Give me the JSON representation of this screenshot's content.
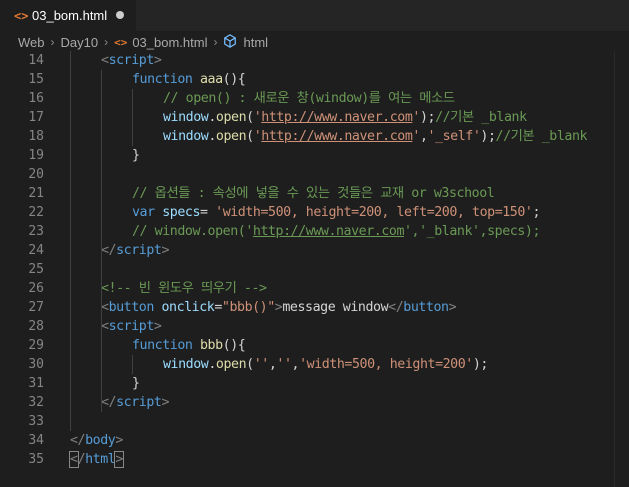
{
  "tab": {
    "filename": "03_bom.html",
    "icon": "html-file-icon"
  },
  "breadcrumb": {
    "parts": [
      "Web",
      "Day10",
      "03_bom.html",
      "html"
    ]
  },
  "lines": [
    {
      "n": 14,
      "indent": 1,
      "tokens": [
        [
          "bracket",
          "<"
        ],
        [
          "tag",
          "script"
        ],
        [
          "bracket",
          ">"
        ]
      ]
    },
    {
      "n": 15,
      "indent": 2,
      "tokens": [
        [
          "kw",
          "function "
        ],
        [
          "fn",
          "aaa"
        ],
        [
          "txt",
          "(){"
        ]
      ]
    },
    {
      "n": 16,
      "indent": 3,
      "tokens": [
        [
          "com",
          "// open() : 새로운 창(window)를 여는 메소드"
        ]
      ]
    },
    {
      "n": 17,
      "indent": 3,
      "tokens": [
        [
          "var",
          "window"
        ],
        [
          "txt",
          "."
        ],
        [
          "fn",
          "open"
        ],
        [
          "txt",
          "("
        ],
        [
          "str",
          "'"
        ],
        [
          "url",
          "http://www.naver.com"
        ],
        [
          "str",
          "'"
        ],
        [
          "txt",
          ");"
        ],
        [
          "com",
          "//기본 _blank"
        ]
      ]
    },
    {
      "n": 18,
      "indent": 3,
      "tokens": [
        [
          "var",
          "window"
        ],
        [
          "txt",
          "."
        ],
        [
          "fn",
          "open"
        ],
        [
          "txt",
          "("
        ],
        [
          "str",
          "'"
        ],
        [
          "url",
          "http://www.naver.com"
        ],
        [
          "str",
          "'"
        ],
        [
          "txt",
          ","
        ],
        [
          "str",
          "'_self'"
        ],
        [
          "txt",
          ");"
        ],
        [
          "com",
          "//기본 _blank"
        ]
      ]
    },
    {
      "n": 19,
      "indent": 2,
      "tokens": [
        [
          "txt",
          "}"
        ]
      ]
    },
    {
      "n": 20,
      "indent": 0,
      "tokens": []
    },
    {
      "n": 21,
      "indent": 2,
      "tokens": [
        [
          "com",
          "// 옵션들 : 속성에 넣을 수 있는 것들은 교재 or w3school"
        ]
      ]
    },
    {
      "n": 22,
      "indent": 2,
      "tokens": [
        [
          "kw",
          "var "
        ],
        [
          "var",
          "specs"
        ],
        [
          "txt",
          "= "
        ],
        [
          "str",
          "'width=500, height=200, left=200, top=150'"
        ],
        [
          "txt",
          ";"
        ]
      ]
    },
    {
      "n": 23,
      "indent": 2,
      "tokens": [
        [
          "com",
          "// window.open('"
        ],
        [
          "urlc",
          "http://www.naver.com"
        ],
        [
          "com",
          "','_blank',specs);"
        ]
      ]
    },
    {
      "n": 24,
      "indent": 1,
      "tokens": [
        [
          "bracket",
          "</"
        ],
        [
          "tag",
          "script"
        ],
        [
          "bracket",
          ">"
        ]
      ]
    },
    {
      "n": 25,
      "indent": 0,
      "tokens": []
    },
    {
      "n": 26,
      "indent": 1,
      "tokens": [
        [
          "com",
          "<!-- 빈 윈도우 띄우기 -->"
        ]
      ]
    },
    {
      "n": 27,
      "indent": 1,
      "tokens": [
        [
          "bracket",
          "<"
        ],
        [
          "tag",
          "button "
        ],
        [
          "attr",
          "onclick"
        ],
        [
          "txt",
          "="
        ],
        [
          "str",
          "\"bbb()\""
        ],
        [
          "bracket",
          ">"
        ],
        [
          "txt",
          "message window"
        ],
        [
          "bracket",
          "</"
        ],
        [
          "tag",
          "button"
        ],
        [
          "bracket",
          ">"
        ]
      ]
    },
    {
      "n": 28,
      "indent": 1,
      "tokens": [
        [
          "bracket",
          "<"
        ],
        [
          "tag",
          "script"
        ],
        [
          "bracket",
          ">"
        ]
      ]
    },
    {
      "n": 29,
      "indent": 2,
      "tokens": [
        [
          "kw",
          "function "
        ],
        [
          "fn",
          "bbb"
        ],
        [
          "txt",
          "(){"
        ]
      ]
    },
    {
      "n": 30,
      "indent": 3,
      "tokens": [
        [
          "var",
          "window"
        ],
        [
          "txt",
          "."
        ],
        [
          "fn",
          "open"
        ],
        [
          "txt",
          "("
        ],
        [
          "str",
          "''"
        ],
        [
          "txt",
          ","
        ],
        [
          "str",
          "''"
        ],
        [
          "txt",
          ","
        ],
        [
          "str",
          "'width=500, height=200'"
        ],
        [
          "txt",
          ");"
        ]
      ]
    },
    {
      "n": 31,
      "indent": 2,
      "tokens": [
        [
          "txt",
          "}"
        ]
      ]
    },
    {
      "n": 32,
      "indent": 1,
      "tokens": [
        [
          "bracket",
          "</"
        ],
        [
          "tag",
          "script"
        ],
        [
          "bracket",
          ">"
        ]
      ]
    },
    {
      "n": 33,
      "indent": 0,
      "tokens": []
    },
    {
      "n": 34,
      "indent": 0,
      "tokens": [
        [
          "bracket",
          "</"
        ],
        [
          "tag",
          "body"
        ],
        [
          "bracket",
          ">"
        ]
      ]
    },
    {
      "n": 35,
      "indent": 0,
      "tokens": [
        [
          "bm",
          "<"
        ],
        [
          "bracket",
          "/"
        ],
        [
          "tag",
          "html"
        ],
        [
          "bm",
          ">"
        ]
      ]
    }
  ]
}
